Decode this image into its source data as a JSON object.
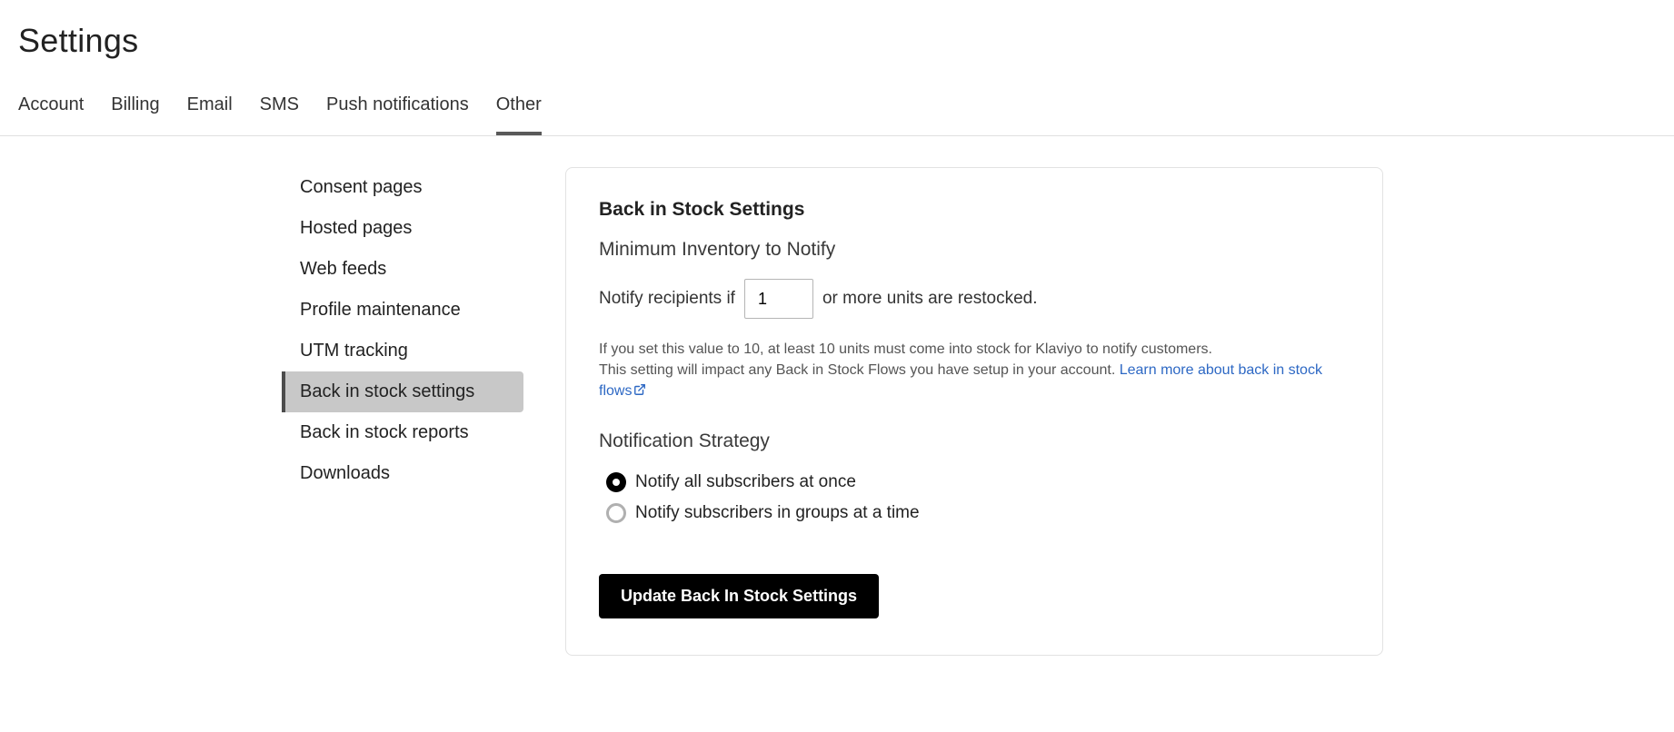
{
  "page_title": "Settings",
  "tabs": [
    {
      "label": "Account",
      "active": false
    },
    {
      "label": "Billing",
      "active": false
    },
    {
      "label": "Email",
      "active": false
    },
    {
      "label": "SMS",
      "active": false
    },
    {
      "label": "Push notifications",
      "active": false
    },
    {
      "label": "Other",
      "active": true
    }
  ],
  "sidebar": {
    "items": [
      {
        "label": "Consent pages",
        "active": false
      },
      {
        "label": "Hosted pages",
        "active": false
      },
      {
        "label": "Web feeds",
        "active": false
      },
      {
        "label": "Profile maintenance",
        "active": false
      },
      {
        "label": "UTM tracking",
        "active": false
      },
      {
        "label": "Back in stock settings",
        "active": true
      },
      {
        "label": "Back in stock reports",
        "active": false
      },
      {
        "label": "Downloads",
        "active": false
      }
    ]
  },
  "panel": {
    "title": "Back in Stock Settings",
    "minimum_inventory": {
      "heading": "Minimum Inventory to Notify",
      "prefix": "Notify recipients if",
      "value": "1",
      "suffix": "or more units are restocked.",
      "help_line1": "If you set this value to 10, at least 10 units must come into stock for Klaviyo to notify customers.",
      "help_line2": "This setting will impact any Back in Stock Flows you have setup in your account. ",
      "link_text": "Learn more about back in stock flows"
    },
    "notification_strategy": {
      "heading": "Notification Strategy",
      "options": [
        {
          "label": "Notify all subscribers at once",
          "selected": true
        },
        {
          "label": "Notify subscribers in groups at a time",
          "selected": false
        }
      ]
    },
    "submit_label": "Update Back In Stock Settings"
  }
}
